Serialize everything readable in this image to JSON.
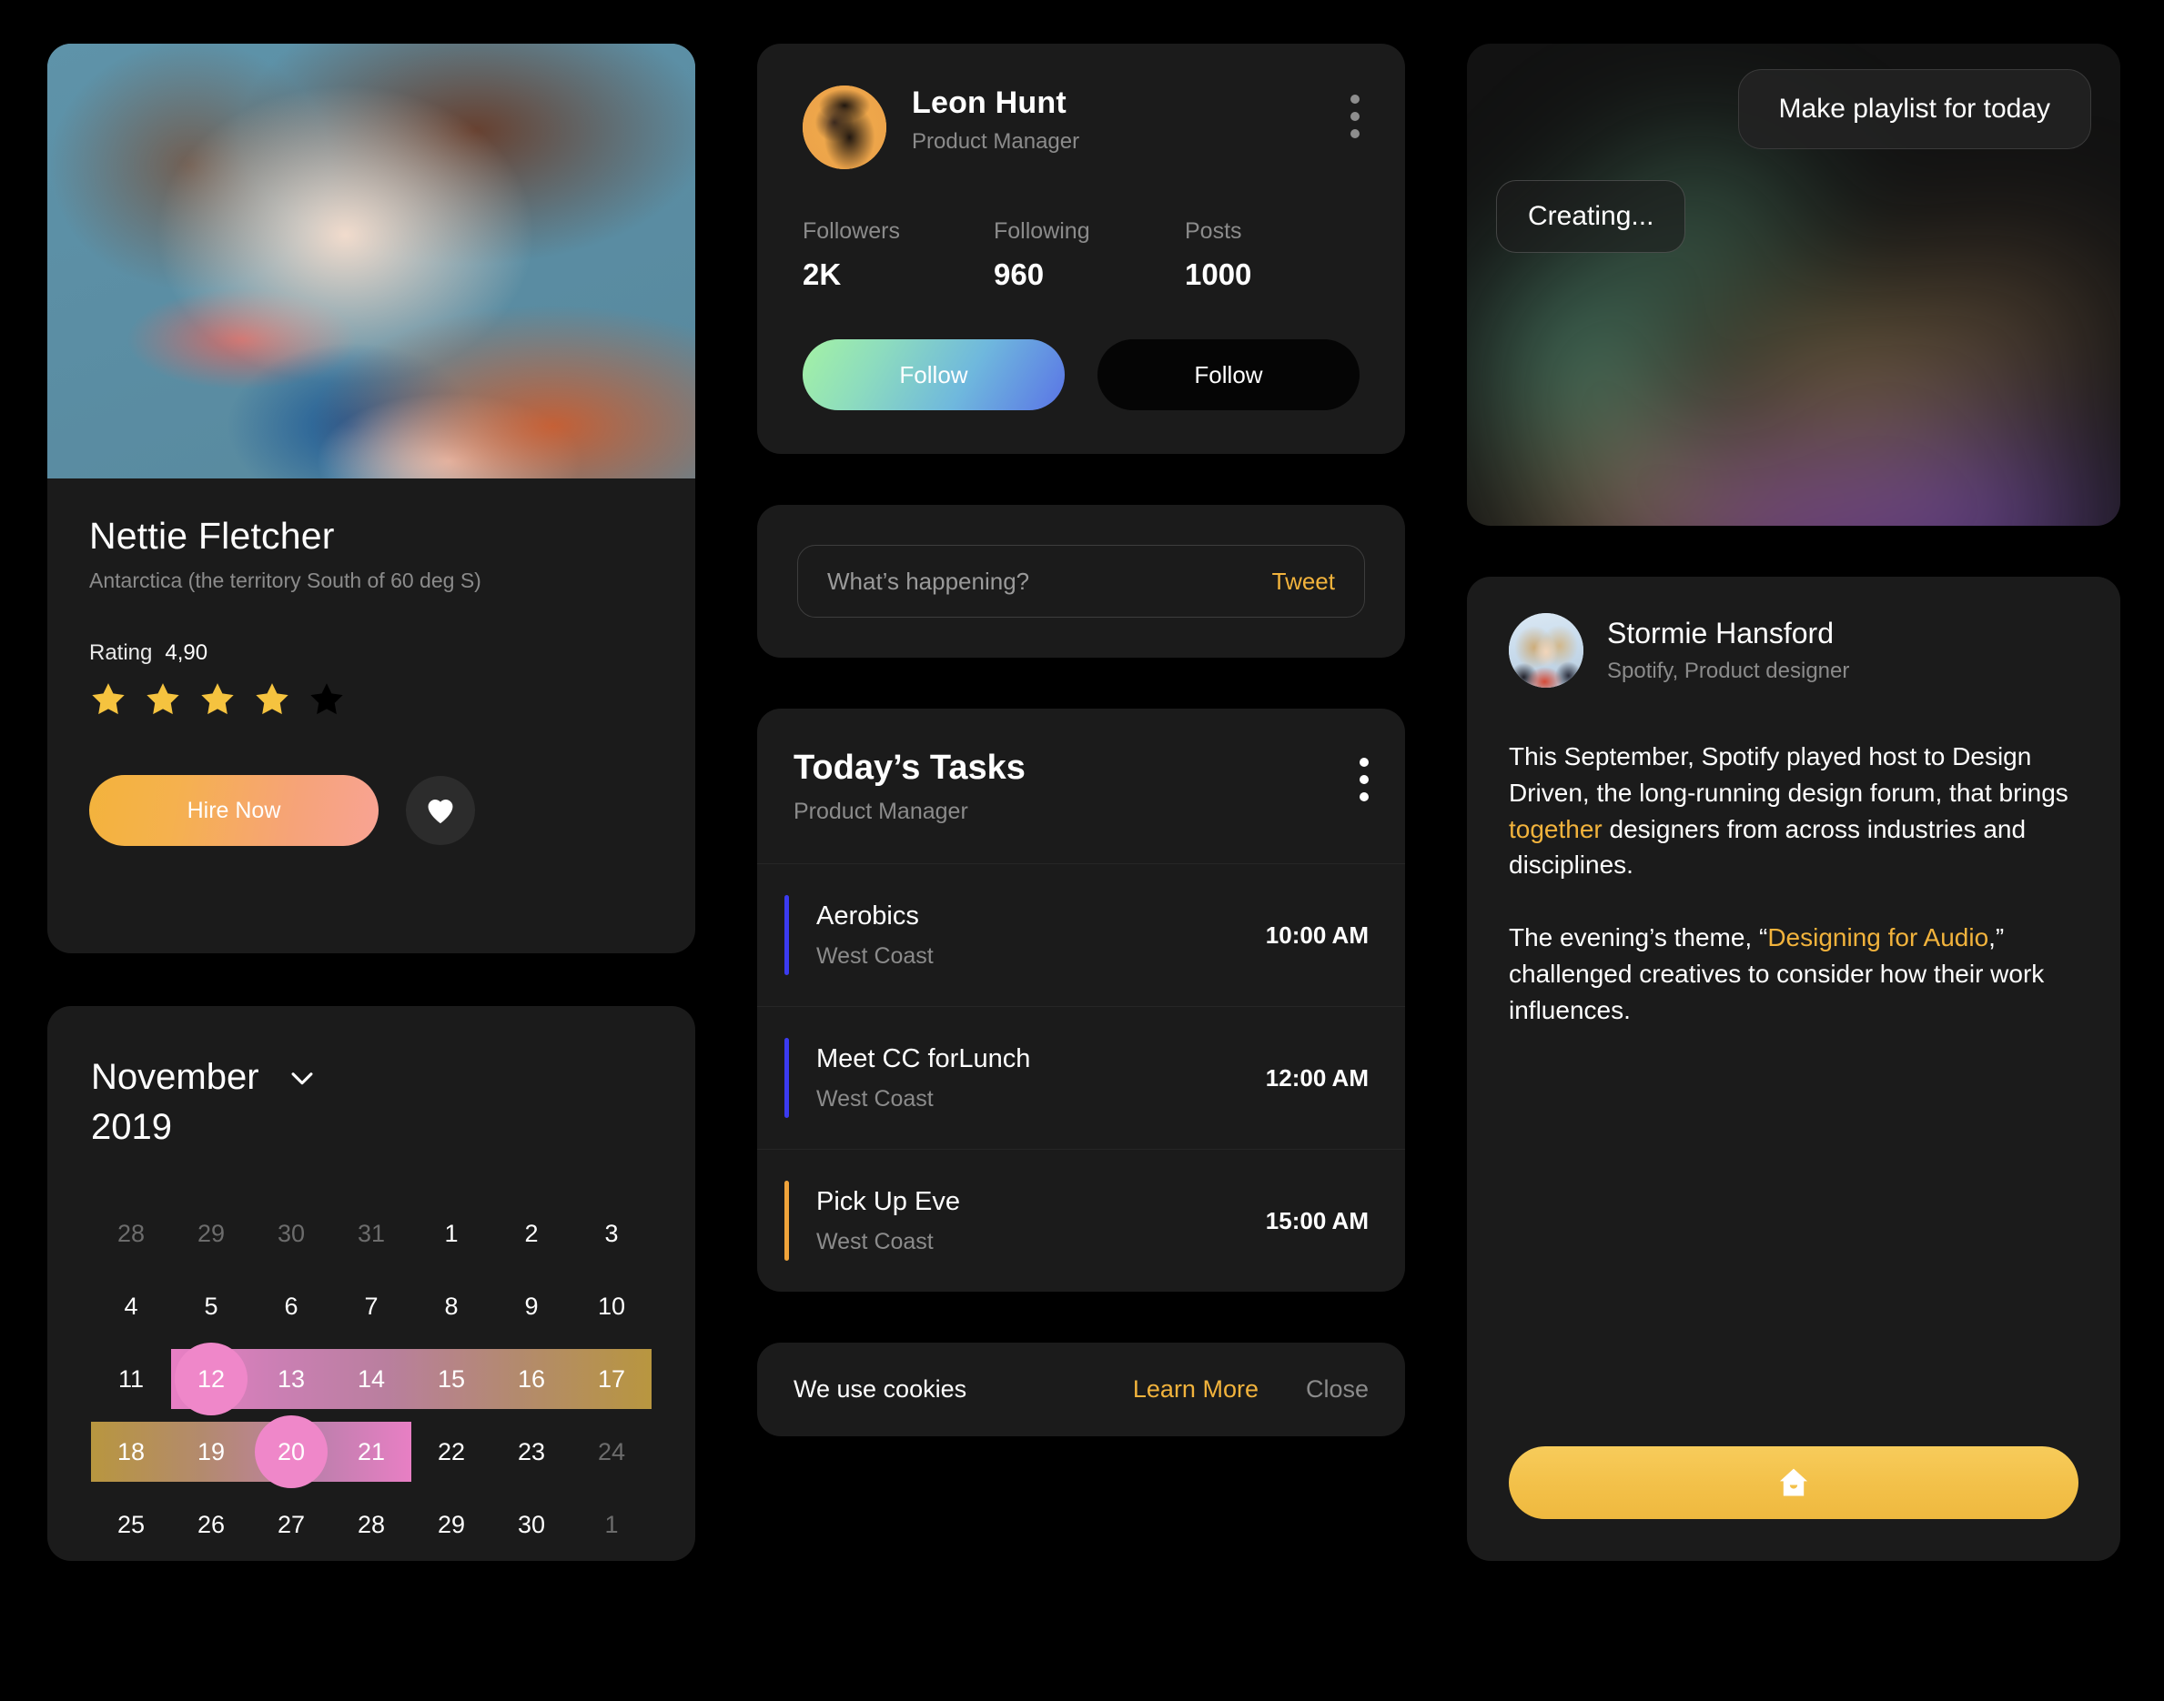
{
  "profile": {
    "name": "Nettie Fletcher",
    "location": "Antarctica (the territory South of 60 deg S)",
    "rating_label": "Rating",
    "rating_value": "4,90",
    "stars_filled": 4,
    "stars_total": 5,
    "hire_label": "Hire Now",
    "favorite_icon": "heart-icon",
    "photo_alt": "portrait-photo"
  },
  "calendar": {
    "month": "November",
    "year": "2019",
    "dropdown_icon": "chevron-down-icon",
    "weeks": [
      [
        {
          "d": "28",
          "muted": true
        },
        {
          "d": "29",
          "muted": true
        },
        {
          "d": "30",
          "muted": true
        },
        {
          "d": "31",
          "muted": true
        },
        {
          "d": "1"
        },
        {
          "d": "2"
        },
        {
          "d": "3"
        }
      ],
      [
        {
          "d": "4"
        },
        {
          "d": "5"
        },
        {
          "d": "6"
        },
        {
          "d": "7"
        },
        {
          "d": "8"
        },
        {
          "d": "9"
        },
        {
          "d": "10"
        }
      ],
      [
        {
          "d": "11"
        },
        {
          "d": "12",
          "selected": true
        },
        {
          "d": "13"
        },
        {
          "d": "14"
        },
        {
          "d": "15"
        },
        {
          "d": "16"
        },
        {
          "d": "17"
        }
      ],
      [
        {
          "d": "18"
        },
        {
          "d": "19"
        },
        {
          "d": "20",
          "selected": true
        },
        {
          "d": "21"
        },
        {
          "d": "22"
        },
        {
          "d": "23"
        },
        {
          "d": "24",
          "muted": true
        }
      ],
      [
        {
          "d": "25"
        },
        {
          "d": "26"
        },
        {
          "d": "27"
        },
        {
          "d": "28"
        },
        {
          "d": "29"
        },
        {
          "d": "30"
        },
        {
          "d": "1",
          "muted": true
        }
      ]
    ],
    "range_start": "12",
    "range_end": "20"
  },
  "social": {
    "name": "Leon Hunt",
    "role": "Product Manager",
    "menu_icon": "more-vertical-icon",
    "avatar_alt": "leon-hunt-avatar",
    "stats": [
      {
        "label": "Followers",
        "value": "2K"
      },
      {
        "label": "Following",
        "value": "960"
      },
      {
        "label": "Posts",
        "value": "1000"
      }
    ],
    "primary_button": "Follow",
    "secondary_button": "Follow"
  },
  "tweet": {
    "placeholder": "What’s happening?",
    "value": "",
    "submit_label": "Tweet"
  },
  "tasks": {
    "title": "Today’s Tasks",
    "subtitle": "Product Manager",
    "menu_icon": "more-vertical-icon",
    "items": [
      {
        "name": "Aerobics",
        "place": "West Coast",
        "time": "10:00 AM",
        "color": "#3b3bf0"
      },
      {
        "name": "Meet CC forLunch",
        "place": "West Coast",
        "time": "12:00 AM",
        "color": "#3b3bf0"
      },
      {
        "name": "Pick Up Eve",
        "place": "West Coast",
        "time": "15:00 AM",
        "color": "#f0a43b"
      }
    ]
  },
  "cookies": {
    "text": "We use cookies",
    "learn_more": "Learn More",
    "close": "Close"
  },
  "playlist": {
    "user_message": "Make playlist for today",
    "bot_message": "Creating..."
  },
  "article": {
    "author": "Stormie Hansford",
    "author_role": "Spotify, Product designer",
    "avatar_alt": "stormie-hansford-avatar",
    "paragraph1_part1": "This September, Spotify played host to Design Driven, the long-running design forum, that brings ",
    "paragraph1_highlight": "together",
    "paragraph1_part2": " designers from across industries and disciplines.",
    "paragraph2_part1": "The evening’s theme, “",
    "paragraph2_highlight": "Designing for Audio",
    "paragraph2_part2": ",” challenged creatives to consider how their work influences.",
    "cta_icon": "home-icon"
  },
  "colors": {
    "page_bg": "#000000",
    "card_bg": "#1b1b1b",
    "accent_gold": "#f2b33c",
    "accent_pink": "#ef87c9",
    "accent_blue": "#3b3bf0",
    "text_primary": "#ffffff",
    "text_muted": "#8b8b8b"
  }
}
